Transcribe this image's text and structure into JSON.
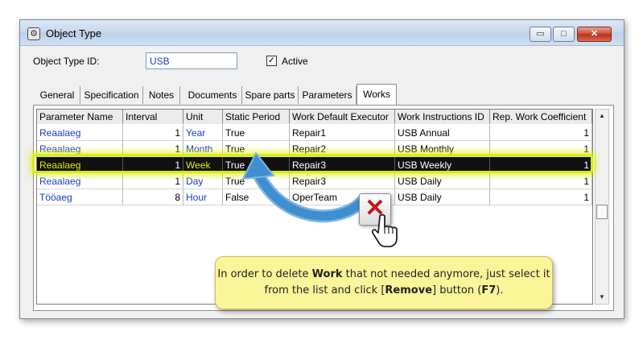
{
  "window": {
    "title": "Object Type",
    "icon": "gear-icon",
    "buttons": {
      "minimize": "▭",
      "maximize": "□",
      "close": "✕"
    }
  },
  "form": {
    "id_label": "Object Type ID:",
    "id_value": "USB",
    "active_checked": true,
    "active_label": "Active"
  },
  "tabs": [
    "General",
    "Specification",
    "Notes",
    "Documents",
    "Spare parts",
    "Parameters",
    "Works"
  ],
  "active_tab": "Works",
  "table": {
    "columns": [
      "Parameter Name",
      "Interval",
      "Unit",
      "Static Period",
      "Work Default Executor",
      "Work Instructions ID",
      "Rep. Work Coefficient"
    ],
    "rows": [
      {
        "name": "Reaalaeg",
        "interval": "1",
        "unit": "Year",
        "static": "True",
        "executor": "Repair1",
        "instructions": "USB Annual",
        "coef": "1"
      },
      {
        "name": "Reaalaeg",
        "interval": "1",
        "unit": "Month",
        "static": "True",
        "executor": "Repair2",
        "instructions": "USB Monthly",
        "coef": "1"
      },
      {
        "name": "Reaalaeg",
        "interval": "1",
        "unit": "Week",
        "static": "True",
        "executor": "Repair3",
        "instructions": "USB Weekly",
        "coef": "1"
      },
      {
        "name": "Reaalaeg",
        "interval": "1",
        "unit": "Day",
        "static": "True",
        "executor": "Repair3",
        "instructions": "USB Daily",
        "coef": "1"
      },
      {
        "name": "Tööaeg",
        "interval": "8",
        "unit": "Hour",
        "static": "False",
        "executor": "OperTeam",
        "instructions": "USB Daily",
        "coef": "1"
      }
    ],
    "selected_row": 2
  },
  "remove_button": {
    "icon": "remove-x-icon",
    "glyph": "✕"
  },
  "tooltip": {
    "part1": "In order to delete ",
    "bold1": "Work",
    "part2": " that not needed anymore, just select it from the list and click [",
    "bold2": "Remove",
    "part3": "] button (",
    "bold3": "F7",
    "part4": ")."
  },
  "colors": {
    "link": "#1a3ccc",
    "selected_bg": "#111111",
    "highlight": "#d8f000",
    "tooltip_bg": "#fbf59a",
    "arrow": "#3e8ed0"
  }
}
